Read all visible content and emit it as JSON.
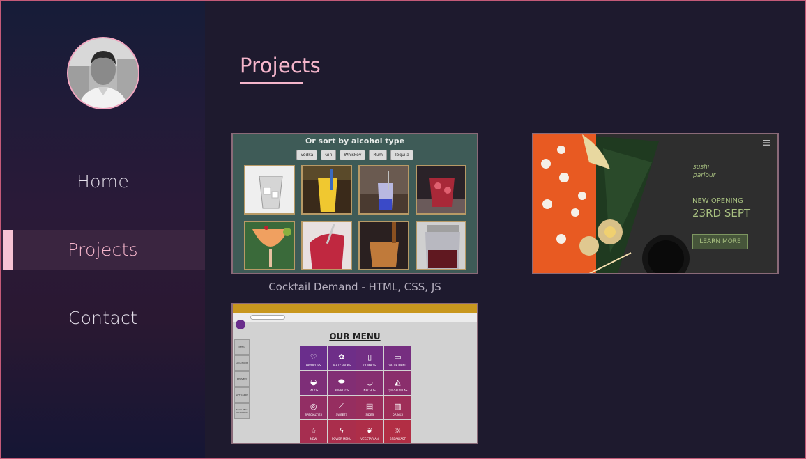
{
  "nav": {
    "home": "Home",
    "projects": "Projects",
    "contact": "Contact"
  },
  "main": {
    "title": "Projects"
  },
  "projects": [
    {
      "caption": "Cocktail Demand - HTML, CSS, JS",
      "heading": "Or sort by alcohol type",
      "filters": [
        "Vodka",
        "Gin",
        "Whiskey",
        "Rum",
        "Tequila"
      ]
    },
    {
      "caption": "",
      "logo_line1": "sushi",
      "logo_line2": "parlour",
      "announcement": "NEW OPENING",
      "date": "23RD SEPT",
      "button": "LEARN MORE"
    },
    {
      "caption": "",
      "menu_title": "OUR MENU",
      "side_tabs": [
        "MENU",
        "LOCATIONS",
        "DELIVERY",
        "GIFT CARDS",
        "TACO BELL REWARDS"
      ],
      "menu_items": [
        "FAVORITES",
        "PARTY PACKS",
        "COMBOS",
        "VALUE MENU",
        "TACOS",
        "BURRITOS",
        "NACHOS",
        "QUESADILLAS",
        "SPECIALTIES",
        "SWEETS",
        "SIDES",
        "DRINKS",
        "NEW",
        "POWER MENU",
        "VEGETARIAN",
        "BREAKFAST"
      ]
    }
  ],
  "colors": {
    "accent": "#f5b5cb",
    "background": "#1e1a2e",
    "sidebar_active": "#3a2540"
  }
}
